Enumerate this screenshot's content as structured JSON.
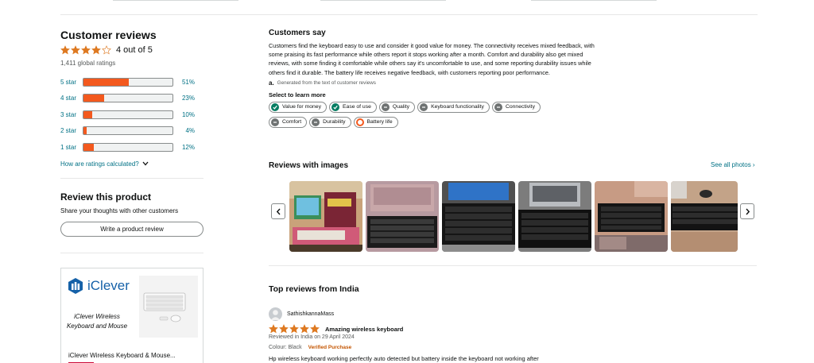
{
  "left": {
    "title": "Customer reviews",
    "average_text": "4 out of 5",
    "average_stars": 4,
    "global_ratings": "1,411 global ratings",
    "histogram": [
      {
        "label": "5 star",
        "percent_text": "51%",
        "value": 51
      },
      {
        "label": "4 star",
        "percent_text": "23%",
        "value": 23
      },
      {
        "label": "3 star",
        "percent_text": "10%",
        "value": 10
      },
      {
        "label": "2 star",
        "percent_text": "4%",
        "value": 4
      },
      {
        "label": "1 star",
        "percent_text": "12%",
        "value": 12
      }
    ],
    "how_calculated": "How are ratings calculated?",
    "review_title": "Review this product",
    "review_subtitle": "Share your thoughts with other customers",
    "write_button": "Write a product review",
    "ad": {
      "brand": "iClever",
      "description": "iClever Wireless Keyboard and Mouse",
      "title": "iClever Wireless Keyboard & Mouse..."
    }
  },
  "summary": {
    "title": "Customers say",
    "body": "Customers find the keyboard easy to use and consider it good value for money. The connectivity receives mixed feedback, with some praising its fast performance while others report it stops working after a month. Comfort and durability also get mixed reviews, with some finding it comfortable while others say it's uncomfortable to use, and some reporting durability issues while others find it durable. The battery life receives negative feedback, with customers reporting poor performance.",
    "ai_mark": "a.",
    "ai_note": "Generated from the text of customer reviews",
    "select_label": "Select to learn more",
    "chips": [
      {
        "label": "Value for money",
        "sentiment": "positive"
      },
      {
        "label": "Ease of use",
        "sentiment": "positive"
      },
      {
        "label": "Quality",
        "sentiment": "mixed"
      },
      {
        "label": "Keyboard functionality",
        "sentiment": "mixed"
      },
      {
        "label": "Connectivity",
        "sentiment": "mixed"
      },
      {
        "label": "Comfort",
        "sentiment": "mixed"
      },
      {
        "label": "Durability",
        "sentiment": "mixed"
      },
      {
        "label": "Battery life",
        "sentiment": "negative"
      }
    ],
    "colors": {
      "positive": "#067d62",
      "mixed": "#6f7373",
      "negative": "#f3591e",
      "star": "#de7921",
      "link": "#007185"
    }
  },
  "images": {
    "title": "Reviews with images",
    "see_all": "See all photos ›",
    "photos": [
      "review-photo-1",
      "review-photo-2",
      "review-photo-3",
      "review-photo-4",
      "review-photo-5",
      "review-photo-6"
    ]
  },
  "top_reviews": {
    "title": "Top reviews from India",
    "review": {
      "name": "SathishkannaMass",
      "stars": 5,
      "headline": "Amazing wireless keyboard",
      "meta": "Reviewed in India on 29 April 2024",
      "colour": "Colour: Black",
      "verified": "Verified Purchase",
      "text": "Hp wireless keyboard working perfectly auto detected but battery inside the keyboard not working after"
    }
  }
}
